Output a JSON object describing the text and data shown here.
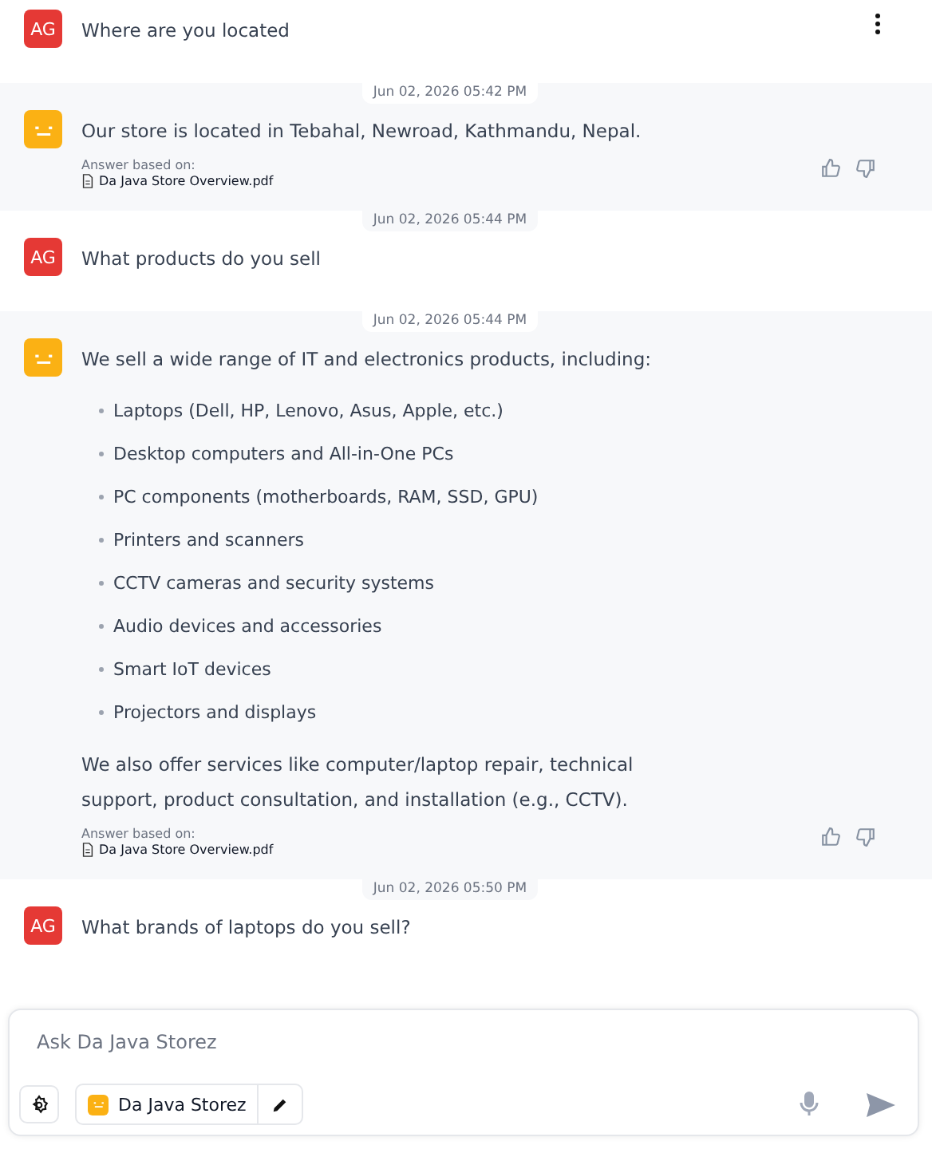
{
  "messages": [
    {
      "kind": "user",
      "avatar": "AG",
      "text": "Where are you located"
    },
    {
      "kind": "bot",
      "timestamp": "Jun 02, 2026 05:42 PM",
      "text": "Our store is located in Tebahal, Newroad, Kathmandu, Nepal.",
      "source_label": "Answer based on:",
      "source_file": "Da Java Store Overview.pdf"
    },
    {
      "kind": "user",
      "timestamp": "Jun 02, 2026 05:44 PM",
      "avatar": "AG",
      "text": "What products do you sell"
    },
    {
      "kind": "bot",
      "timestamp": "Jun 02, 2026 05:44 PM",
      "text": "We sell a wide range of IT and electronics products, including:",
      "bullets": [
        "Laptops (Dell, HP, Lenovo, Asus, Apple, etc.)",
        "Desktop computers and All-in-One PCs",
        "PC components (motherboards, RAM, SSD, GPU)",
        "Printers and scanners",
        "CCTV cameras and security systems",
        "Audio devices and accessories",
        "Smart IoT devices",
        "Projectors and displays"
      ],
      "closing": "We also offer services like computer/laptop repair, technical support, product consultation, and installation (e.g., CCTV).",
      "source_label": "Answer based on:",
      "source_file": "Da Java Store Overview.pdf"
    },
    {
      "kind": "user",
      "timestamp": "Jun 02, 2026 05:50 PM",
      "avatar": "AG",
      "text": "What brands of laptops do you sell?"
    }
  ],
  "composer": {
    "placeholder": "Ask Da Java Storez",
    "agent_name": "Da Java Storez"
  }
}
